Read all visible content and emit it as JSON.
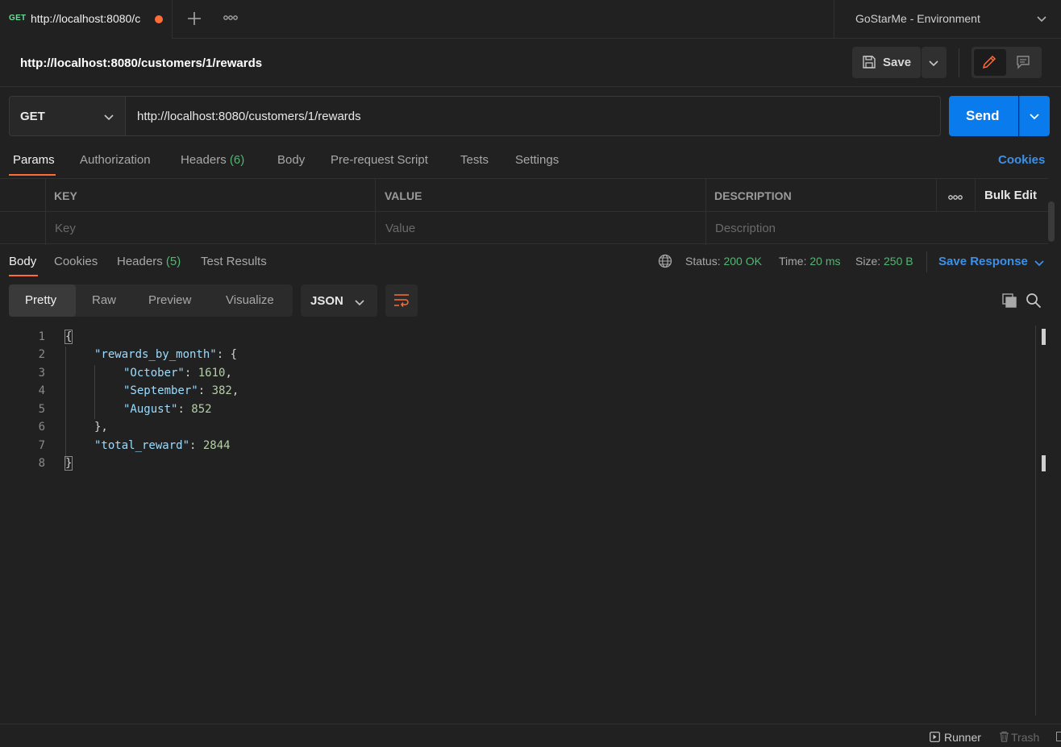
{
  "tab": {
    "method": "GET",
    "url": "http://localhost:8080/c"
  },
  "environment": {
    "label": "GoStarMe - Environment"
  },
  "request": {
    "title": "http://localhost:8080/customers/1/rewards",
    "method": "GET",
    "url": "http://localhost:8080/customers/1/rewards"
  },
  "toolbar": {
    "save_label": "Save",
    "send_label": "Send"
  },
  "request_tabs": {
    "params": "Params",
    "authorization": "Authorization",
    "headers": "Headers",
    "headers_count": "(6)",
    "body": "Body",
    "prerequest": "Pre-request Script",
    "tests": "Tests",
    "settings": "Settings",
    "cookies": "Cookies"
  },
  "params_table": {
    "col_key": "KEY",
    "col_value": "VALUE",
    "col_description": "DESCRIPTION",
    "bulk_edit": "Bulk Edit",
    "key_placeholder": "Key",
    "value_placeholder": "Value",
    "description_placeholder": "Description"
  },
  "response_tabs": {
    "body": "Body",
    "cookies": "Cookies",
    "headers": "Headers",
    "headers_count": "(5)",
    "test_results": "Test Results"
  },
  "response_status": {
    "status_label": "Status:",
    "status_value": "200 OK",
    "time_label": "Time:",
    "time_value": "20 ms",
    "size_label": "Size:",
    "size_value": "250 B",
    "save_response": "Save Response"
  },
  "view_modes": {
    "pretty": "Pretty",
    "raw": "Raw",
    "preview": "Preview",
    "visualize": "Visualize",
    "format": "JSON"
  },
  "code_lines": {
    "l1": "{",
    "l2_key": "\"rewards_by_month\"",
    "l2_rest": ": {",
    "l3_key": "\"October\"",
    "l3_val": "1610",
    "l4_key": "\"September\"",
    "l4_val": "382",
    "l5_key": "\"August\"",
    "l5_val": "852",
    "l6": "},",
    "l7_key": "\"total_reward\"",
    "l7_val": "2844",
    "l8": "}"
  },
  "footer": {
    "runner": "Runner",
    "trash": "Trash"
  },
  "colors": {
    "accent": "#ff6c37",
    "send": "#097bed",
    "link": "#3e90e6",
    "success": "#53b673"
  }
}
